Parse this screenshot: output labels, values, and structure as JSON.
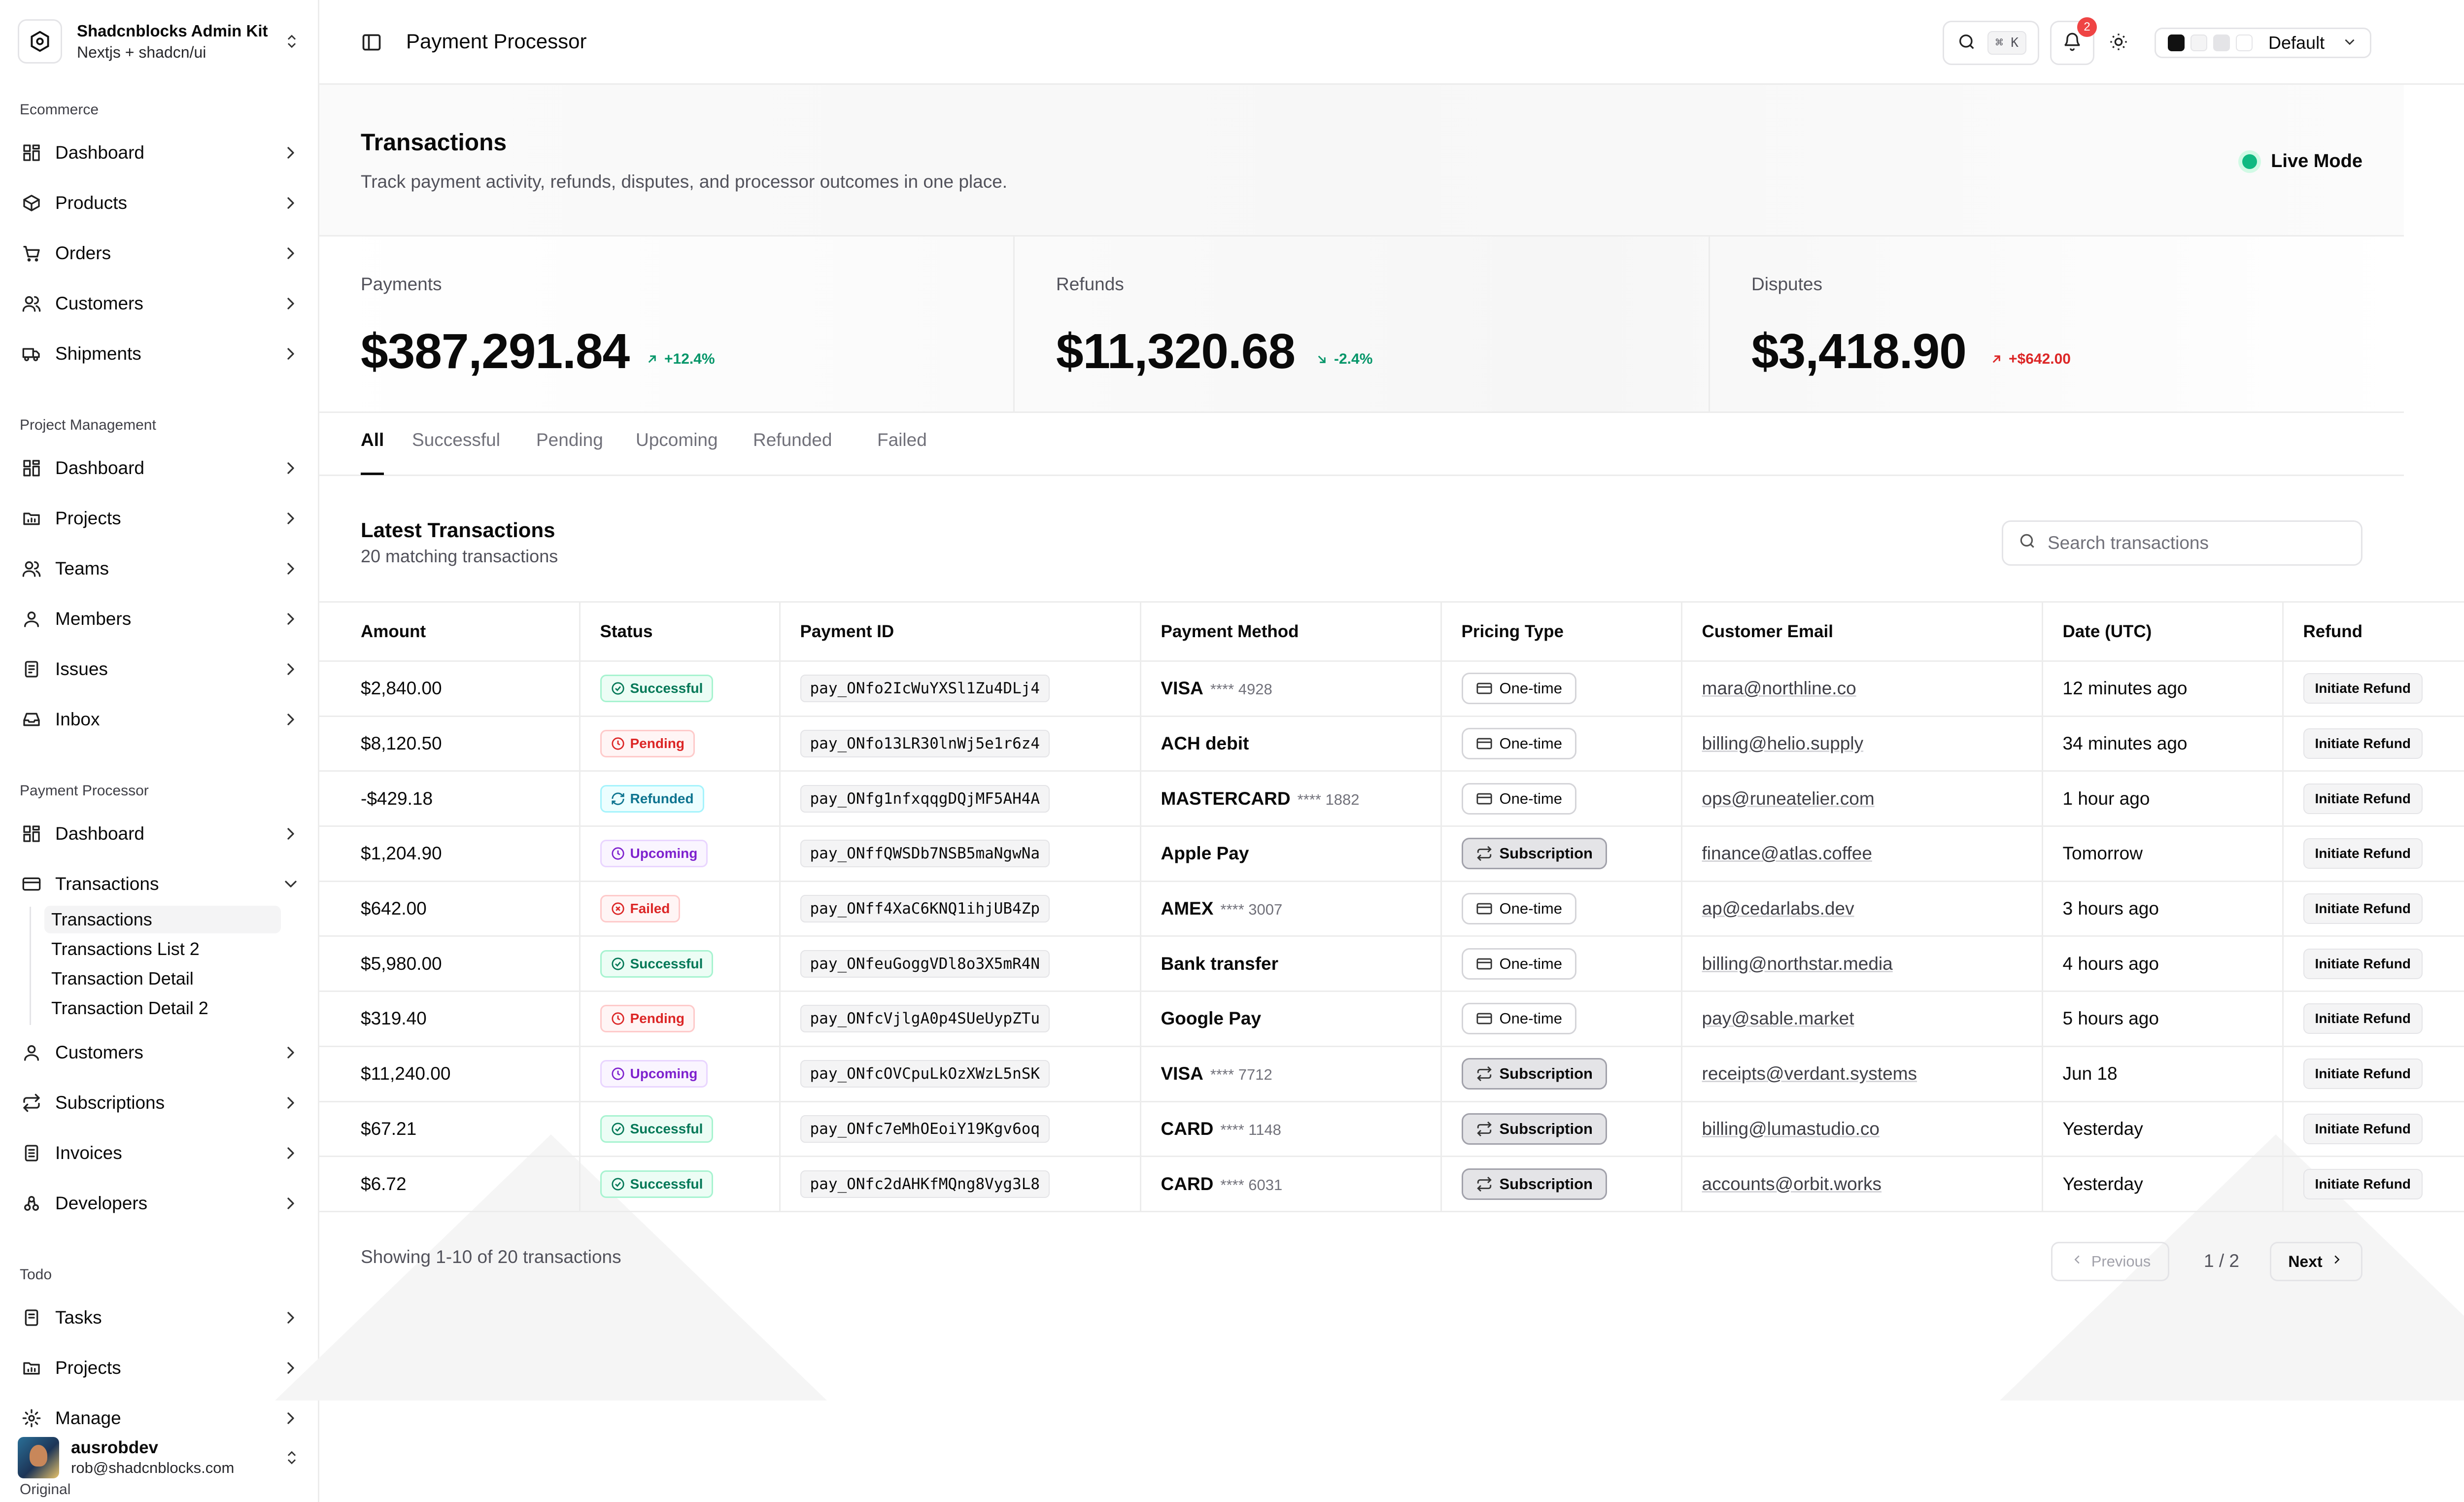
{
  "brand": {
    "title": "Shadcnblocks Admin Kit",
    "subtitle": "Nextjs + shadcn/ui"
  },
  "sidebar": {
    "groups": [
      {
        "label": "Ecommerce",
        "items": [
          "Dashboard",
          "Products",
          "Orders",
          "Customers",
          "Shipments"
        ]
      },
      {
        "label": "Project Management",
        "items": [
          "Dashboard",
          "Projects",
          "Teams",
          "Members",
          "Issues",
          "Inbox"
        ]
      },
      {
        "label": "Payment Processor",
        "items": [
          "Dashboard",
          "Transactions",
          "Customers",
          "Subscriptions",
          "Invoices",
          "Developers"
        ]
      },
      {
        "label": "Todo",
        "items": [
          "Tasks",
          "Projects",
          "Manage"
        ]
      }
    ],
    "transactions_sub": [
      "Transactions",
      "Transactions List 2",
      "Transaction Detail",
      "Transaction Detail 2"
    ],
    "user": {
      "name": "ausrobdev",
      "email": "rob@shadcnblocks.com"
    },
    "footer_label": "Original"
  },
  "header": {
    "title": "Payment Processor",
    "search_kbd": "⌘ K",
    "notifications": "2",
    "theme": "Default"
  },
  "hero": {
    "title": "Transactions",
    "subtitle": "Track payment activity, refunds, disputes, and processor outcomes in one place.",
    "mode": "Live Mode"
  },
  "stats": [
    {
      "label": "Payments",
      "value": "$387,291.84",
      "delta": "+12.4%",
      "dir": "up"
    },
    {
      "label": "Refunds",
      "value": "$11,320.68",
      "delta": "-2.4%",
      "dir": "down-green"
    },
    {
      "label": "Disputes",
      "value": "$3,418.90",
      "delta": "+$642.00",
      "dir": "up-red"
    }
  ],
  "tabs": [
    "All",
    "Successful",
    "Pending",
    "Upcoming",
    "Refunded",
    "Failed"
  ],
  "list": {
    "title": "Latest Transactions",
    "subtitle": "20 matching transactions",
    "search_placeholder": "Search transactions"
  },
  "table": {
    "columns": [
      "Amount",
      "Status",
      "Payment ID",
      "Payment Method",
      "Pricing Type",
      "Customer Email",
      "Date (UTC)",
      "Refund"
    ],
    "refund_label": "Initiate Refund",
    "rows": [
      {
        "amount": "$2,840.00",
        "status": "Successful",
        "id": "pay_ONfo2IcWuYXSl1Zu4DLj4",
        "method": "VISA",
        "last4": "**** 4928",
        "type": "One-time",
        "email": "mara@northline.co",
        "date": "12 minutes ago"
      },
      {
        "amount": "$8,120.50",
        "status": "Pending",
        "id": "pay_ONfo13LR30lnWj5e1r6z4",
        "method": "ACH debit",
        "last4": "",
        "type": "One-time",
        "email": "billing@helio.supply",
        "date": "34 minutes ago"
      },
      {
        "amount": "-$429.18",
        "status": "Refunded",
        "id": "pay_ONfg1nfxqqgDQjMF5AH4A",
        "method": "MASTERCARD",
        "last4": "**** 1882",
        "type": "One-time",
        "email": "ops@runeatelier.com",
        "date": "1 hour ago"
      },
      {
        "amount": "$1,204.90",
        "status": "Upcoming",
        "id": "pay_ONffQWSDb7NSB5maNgwNa",
        "method": "Apple Pay",
        "last4": "",
        "type": "Subscription",
        "email": "finance@atlas.coffee",
        "date": "Tomorrow"
      },
      {
        "amount": "$642.00",
        "status": "Failed",
        "id": "pay_ONff4XaC6KNQ1ihjUB4Zp",
        "method": "AMEX",
        "last4": "**** 3007",
        "type": "One-time",
        "email": "ap@cedarlabs.dev",
        "date": "3 hours ago"
      },
      {
        "amount": "$5,980.00",
        "status": "Successful",
        "id": "pay_ONfeuGoggVDl8o3X5mR4N",
        "method": "Bank transfer",
        "last4": "",
        "type": "One-time",
        "email": "billing@northstar.media",
        "date": "4 hours ago"
      },
      {
        "amount": "$319.40",
        "status": "Pending",
        "id": "pay_ONfcVjlgA0p4SUeUypZTu",
        "method": "Google Pay",
        "last4": "",
        "type": "One-time",
        "email": "pay@sable.market",
        "date": "5 hours ago"
      },
      {
        "amount": "$11,240.00",
        "status": "Upcoming",
        "id": "pay_ONfcOVCpuLkOzXWzL5nSK",
        "method": "VISA",
        "last4": "**** 7712",
        "type": "Subscription",
        "email": "receipts@verdant.systems",
        "date": "Jun 18"
      },
      {
        "amount": "$67.21",
        "status": "Successful",
        "id": "pay_ONfc7eMhOEoiY19Kgv6oq",
        "method": "CARD",
        "last4": "**** 1148",
        "type": "Subscription",
        "email": "billing@lumastudio.co",
        "date": "Yesterday"
      },
      {
        "amount": "$6.72",
        "status": "Successful",
        "id": "pay_ONfc2dAHKfMQng8Vyg3L8",
        "method": "CARD",
        "last4": "**** 6031",
        "type": "Subscription",
        "email": "accounts@orbit.works",
        "date": "Yesterday"
      }
    ]
  },
  "pagination": {
    "summary": "Showing 1-10 of 20 transactions",
    "prev": "Previous",
    "page": "1 / 2",
    "next": "Next"
  }
}
